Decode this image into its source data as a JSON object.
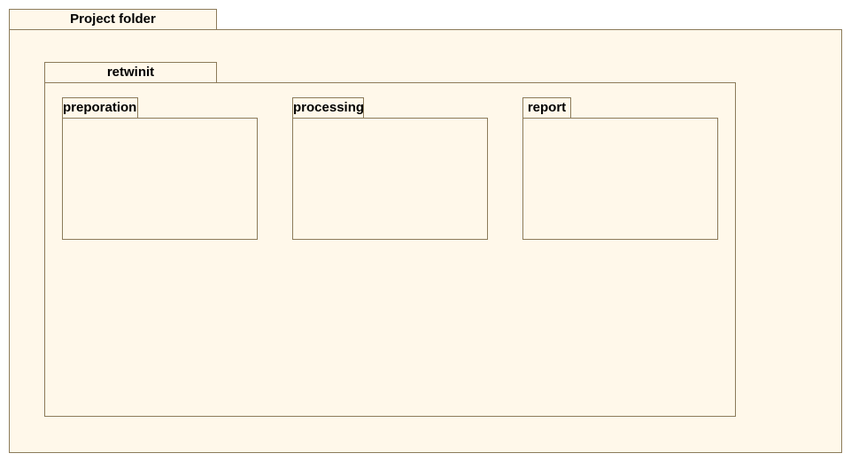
{
  "diagram": {
    "packages": [
      {
        "id": "project_folder",
        "label": "Project folder"
      },
      {
        "id": "retwinit",
        "label": "retwinit",
        "parent": "project_folder"
      },
      {
        "id": "preporation",
        "label": "preporation",
        "parent": "retwinit"
      },
      {
        "id": "processing",
        "label": "processing",
        "parent": "retwinit"
      },
      {
        "id": "report",
        "label": "report",
        "parent": "retwinit"
      }
    ],
    "colors": {
      "fill": "#fff8ea",
      "border": "#8c7b5a",
      "text": "#000000",
      "background": "#ffffff"
    }
  }
}
